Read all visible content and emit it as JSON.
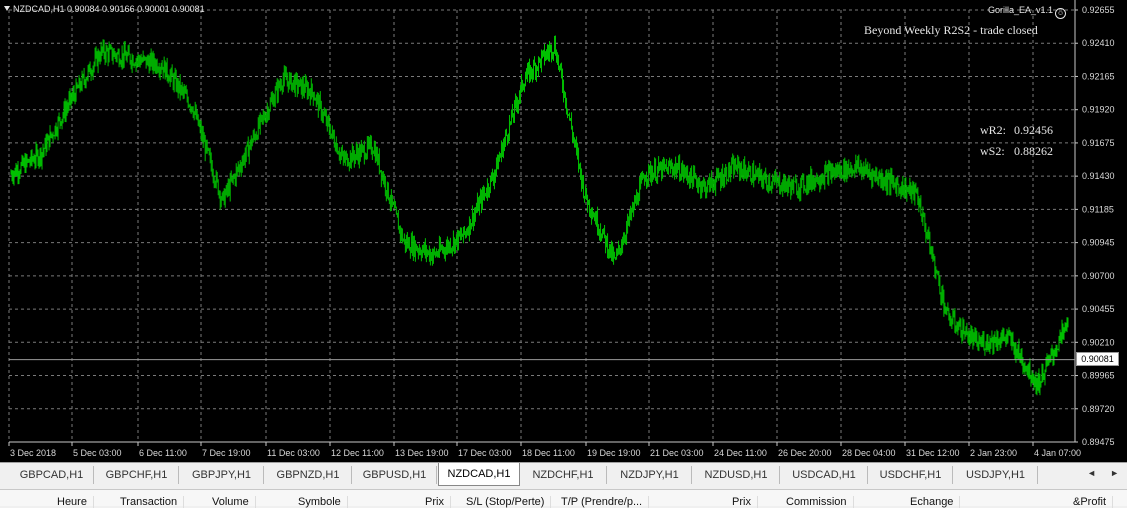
{
  "chart": {
    "header": "NZDCAD,H1  0.90084 0.90166 0.90001 0.90081",
    "ea_label": "Gorilla_EA_v1.1",
    "ea_icon": "smiley-icon",
    "status_message": "Beyond Weekly R2S2 - trade closed",
    "wr2_label": "wR2:",
    "wr2_value": "0.92456",
    "ws2_label": "wS2:",
    "ws2_value": "0.88262",
    "current_price": "0.90081",
    "candle_color": "#00c000",
    "background": "#000000"
  },
  "chart_data": {
    "type": "line",
    "symbol": "NZDCAD,H1",
    "ylim": [
      0.89475,
      0.92655
    ],
    "y_ticks": [
      "0.92655",
      "0.92410",
      "0.92165",
      "0.91920",
      "0.91675",
      "0.91430",
      "0.91185",
      "0.90945",
      "0.90700",
      "0.90455",
      "0.90210",
      "0.89965",
      "0.89720",
      "0.89475"
    ],
    "x_ticks": [
      "3 Dec 2018",
      "5 Dec 03:00",
      "6 Dec 11:00",
      "7 Dec 19:00",
      "11 Dec 03:00",
      "12 Dec 11:00",
      "13 Dec 19:00",
      "17 Dec 03:00",
      "18 Dec 11:00",
      "19 Dec 19:00",
      "21 Dec 03:00",
      "24 Dec 11:00",
      "26 Dec 20:00",
      "28 Dec 04:00",
      "31 Dec 12:00",
      "2 Jan 23:00",
      "4 Jan 07:00"
    ],
    "series": [
      {
        "x": [
          "3 Dec 2018",
          "4 Dec",
          "5 Dec 03:00",
          "5 Dec",
          "6 Dec 11:00",
          "6 Dec",
          "7 Dec",
          "7 Dec 19:00",
          "10 Dec",
          "11 Dec 03:00",
          "11 Dec",
          "12 Dec 11:00",
          "13 Dec",
          "13 Dec 19:00",
          "14 Dec",
          "17 Dec 03:00",
          "17 Dec",
          "18 Dec 11:00",
          "18 Dec",
          "19 Dec 19:00",
          "20 Dec",
          "21 Dec 03:00",
          "21 Dec",
          "24 Dec 11:00",
          "25 Dec",
          "26 Dec 20:00",
          "27 Dec",
          "28 Dec 04:00",
          "28 Dec",
          "31 Dec 12:00",
          "1 Jan",
          "2 Jan",
          "2 Jan 23:00",
          "3 Jan",
          "4 Jan",
          "4 Jan 07:00"
        ],
        "values": [
          0.9145,
          0.916,
          0.92,
          0.9235,
          0.923,
          0.9225,
          0.9195,
          0.9125,
          0.917,
          0.9215,
          0.9205,
          0.9155,
          0.9165,
          0.9095,
          0.9085,
          0.91,
          0.9145,
          0.9215,
          0.924,
          0.913,
          0.908,
          0.9145,
          0.915,
          0.9135,
          0.915,
          0.914,
          0.9135,
          0.9145,
          0.915,
          0.914,
          0.913,
          0.904,
          0.902,
          0.9025,
          0.899,
          0.9035
        ]
      }
    ]
  },
  "tabs": {
    "items": [
      "GBPCAD,H1",
      "GBPCHF,H1",
      "GBPJPY,H1",
      "GBPNZD,H1",
      "GBPUSD,H1",
      "NZDCAD,H1",
      "NZDCHF,H1",
      "NZDJPY,H1",
      "NZDUSD,H1",
      "USDCAD,H1",
      "USDCHF,H1",
      "USDJPY,H1"
    ],
    "active": "NZDCAD,H1",
    "scroll_left": "◄",
    "scroll_right": "►"
  },
  "columns": [
    "Heure",
    "Transaction",
    "Volume",
    "Symbole",
    "Prix",
    "S/L (Stop/Perte)",
    "T/P (Prendre/p...",
    "Prix",
    "Commission",
    "Echange",
    "&Profit"
  ]
}
